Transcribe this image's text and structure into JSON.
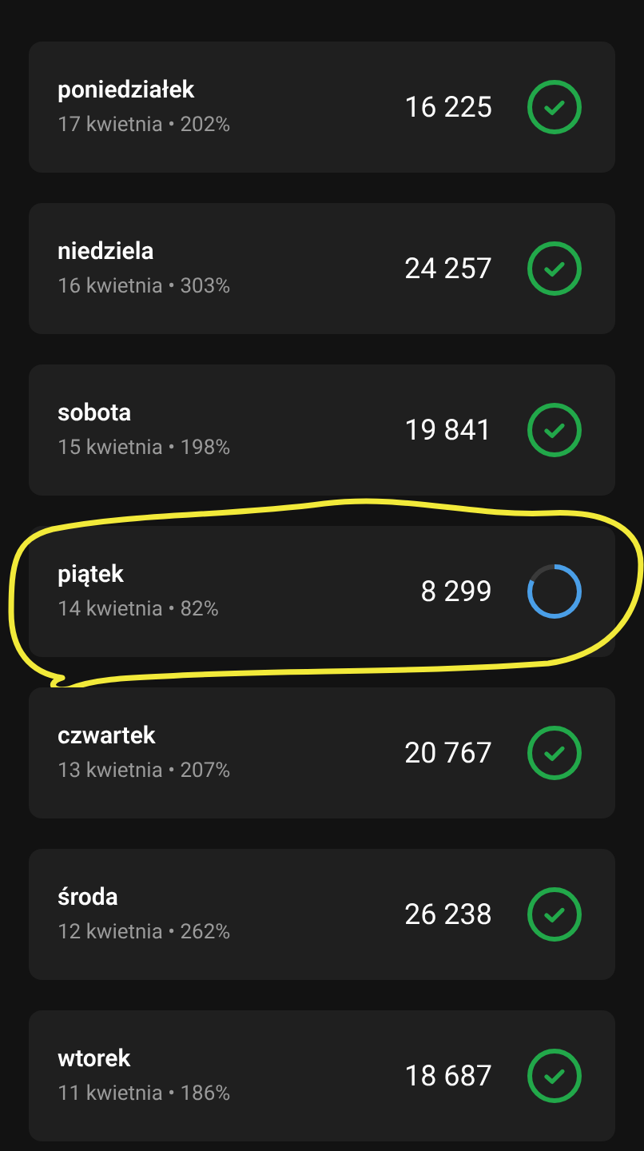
{
  "days": [
    {
      "name": "poniedziałek",
      "detail": "17 kwietnia • 202%",
      "count": "16 225",
      "kind": "done",
      "circled": false
    },
    {
      "name": "niedziela",
      "detail": "16 kwietnia • 303%",
      "count": "24 257",
      "kind": "done",
      "circled": false
    },
    {
      "name": "sobota",
      "detail": "15 kwietnia • 198%",
      "count": "19 841",
      "kind": "done",
      "circled": false
    },
    {
      "name": "piątek",
      "detail": "14 kwietnia • 82%",
      "count": "8 299",
      "kind": "progress",
      "level": 0.82,
      "circled": true
    },
    {
      "name": "czwartek",
      "detail": "13 kwietnia • 207%",
      "count": "20 767",
      "kind": "done",
      "circled": false
    },
    {
      "name": "środa",
      "detail": "12 kwietnia • 262%",
      "count": "26 238",
      "kind": "done",
      "circled": false
    },
    {
      "name": "wtorek",
      "detail": "11 kwietnia • 186%",
      "count": "18 687",
      "kind": "done",
      "circled": false
    }
  ]
}
